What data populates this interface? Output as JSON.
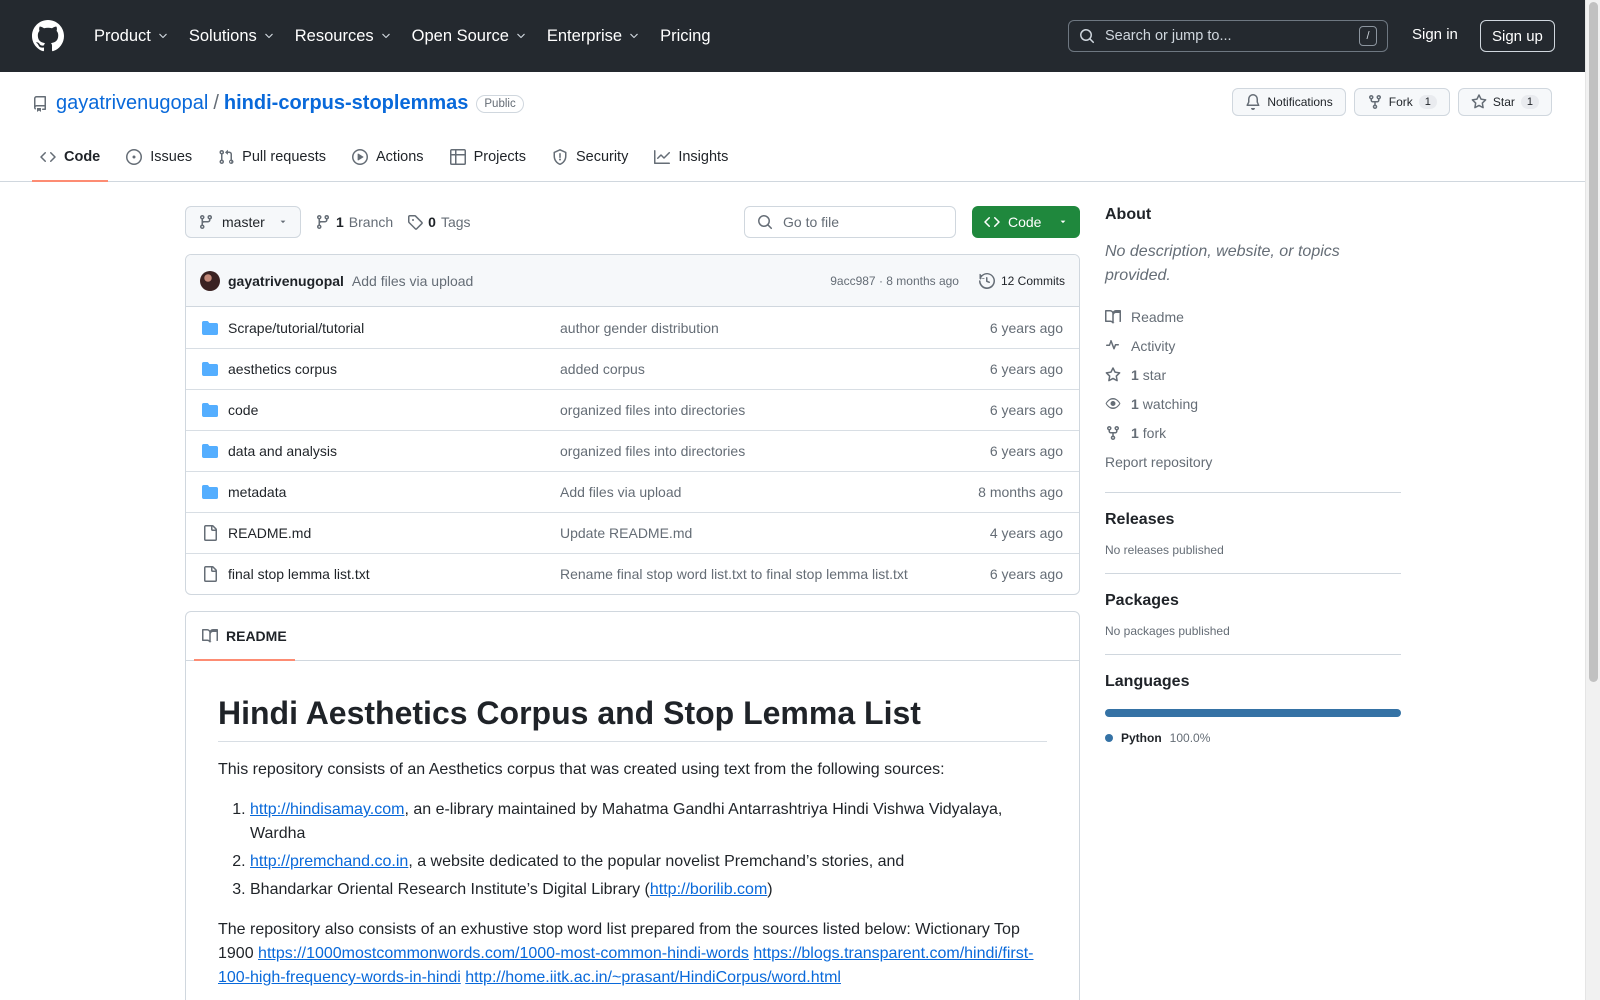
{
  "header": {
    "nav": [
      "Product",
      "Solutions",
      "Resources",
      "Open Source",
      "Enterprise",
      "Pricing"
    ],
    "search_placeholder": "Search or jump to...",
    "search_key": "/",
    "sign_in": "Sign in",
    "sign_up": "Sign up"
  },
  "repo": {
    "owner": "gayatrivenugopal",
    "sep": "/",
    "name": "hindi-corpus-stoplemmas",
    "visibility": "Public",
    "notifications": "Notifications",
    "fork_label": "Fork",
    "fork_count": "1",
    "star_label": "Star",
    "star_count": "1"
  },
  "tabs": [
    "Code",
    "Issues",
    "Pull requests",
    "Actions",
    "Projects",
    "Security",
    "Insights"
  ],
  "toolbar": {
    "branch": "master",
    "branch_count": "1",
    "branch_label": "Branch",
    "tag_count": "0",
    "tag_label": "Tags",
    "goto_placeholder": "Go to file",
    "code_button": "Code"
  },
  "commit": {
    "author": "gayatrivenugopal",
    "message": "Add files via upload",
    "hash_time": "9acc987 · 8 months ago",
    "commits": "12 Commits"
  },
  "files": [
    {
      "type": "dir",
      "name": "Scrape/tutorial/tutorial",
      "message": "author gender distribution",
      "date": "6 years ago"
    },
    {
      "type": "dir",
      "name": "aesthetics corpus",
      "message": "added corpus",
      "date": "6 years ago"
    },
    {
      "type": "dir",
      "name": "code",
      "message": "organized files into directories",
      "date": "6 years ago"
    },
    {
      "type": "dir",
      "name": "data and analysis",
      "message": "organized files into directories",
      "date": "6 years ago"
    },
    {
      "type": "dir",
      "name": "metadata",
      "message": "Add files via upload",
      "date": "8 months ago"
    },
    {
      "type": "file",
      "name": "README.md",
      "message": "Update README.md",
      "date": "4 years ago"
    },
    {
      "type": "file",
      "name": "final stop lemma list.txt",
      "message": "Rename final stop word list.txt to final stop lemma list.txt",
      "date": "6 years ago"
    }
  ],
  "readme": {
    "tab": "README",
    "title": "Hindi Aesthetics Corpus and Stop Lemma List",
    "intro": "This repository consists of an Aesthetics corpus that was created using text from the following sources:",
    "sources": [
      {
        "link": "http://hindisamay.com",
        "text": ", an e-library maintained by Mahatma Gandhi Antarrashtriya Hindi Vishwa Vidyalaya, Wardha"
      },
      {
        "link": "http://premchand.co.in",
        "text": ", a website dedicated to the popular novelist Premchand’s stories, and"
      },
      {
        "pre": "Bhandarkar Oriental Research Institute’s Digital Library (",
        "link": "http://borilib.com",
        "post": ")"
      }
    ],
    "stop_intro": "The repository also consists of an exhustive stop word list prepared from the sources listed below: Wictionary Top 1900",
    "stop_links": [
      "https://1000mostcommonwords.com/1000-most-common-hindi-words",
      "https://blogs.transparent.com/hindi/first-100-high-frequency-words-in-hindi",
      "http://home.iitk.ac.in/~prasant/HindiCorpus/word.html"
    ]
  },
  "about": {
    "title": "About",
    "description": "No description, website, or topics provided.",
    "readme": "Readme",
    "activity": "Activity",
    "stars_count": "1",
    "stars_label": "star",
    "watching_count": "1",
    "watching_label": "watching",
    "forks_count": "1",
    "forks_label": "fork",
    "report": "Report repository"
  },
  "releases": {
    "title": "Releases",
    "text": "No releases published"
  },
  "packages": {
    "title": "Packages",
    "text": "No packages published"
  },
  "languages": {
    "title": "Languages",
    "items": [
      {
        "name": "Python",
        "percent": "100.0%",
        "color": "#3572a5"
      }
    ]
  }
}
